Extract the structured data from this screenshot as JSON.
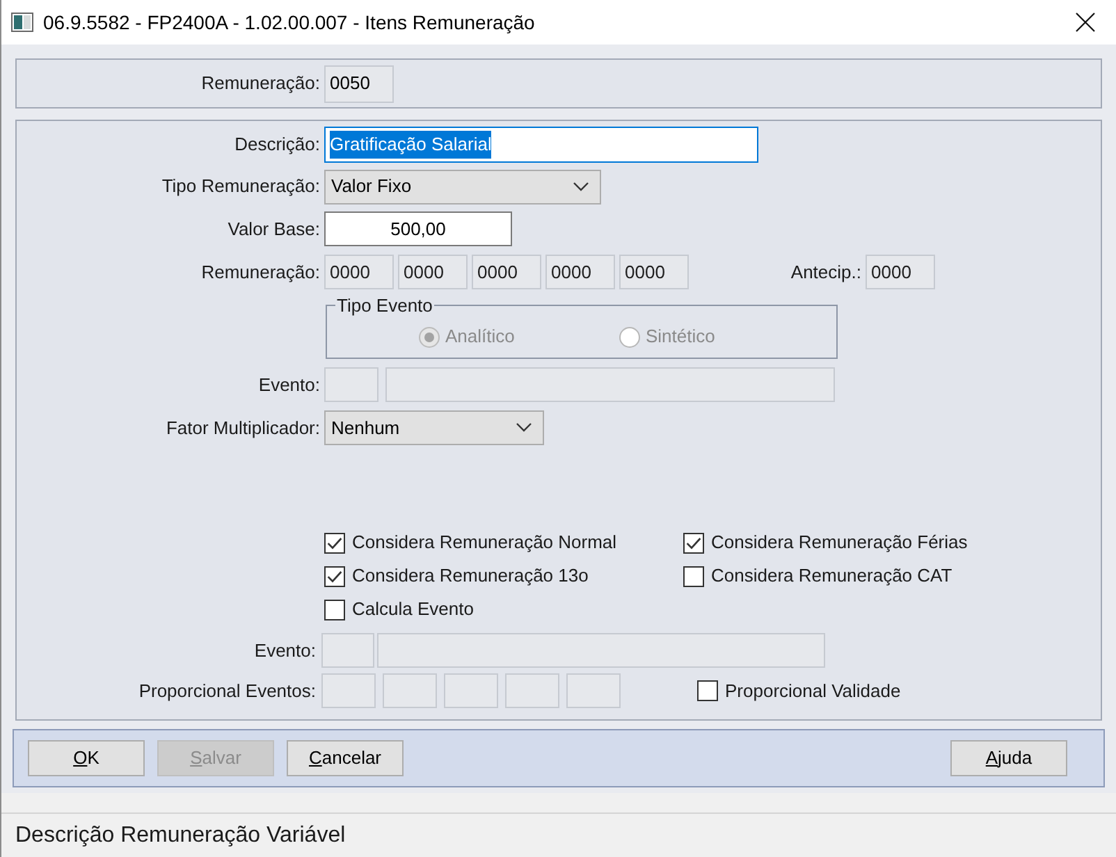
{
  "window": {
    "title": "06.9.5582 - FP2400A - 1.02.00.007 - Itens Remuneração"
  },
  "header_panel": {
    "label": "Remuneração:",
    "value": "0050",
    "disabled": true
  },
  "form": {
    "descricao": {
      "label": "Descrição:",
      "value": "Gratificação Salarial",
      "focused": true
    },
    "tipo_remuneracao": {
      "label": "Tipo Remuneração:",
      "value": "Valor Fixo"
    },
    "valor_base": {
      "label": "Valor Base:",
      "value": "500,00",
      "disabled": false
    },
    "remuneracao": {
      "label": "Remuneração:",
      "fields": [
        {
          "value": "0000",
          "disabled": true
        },
        {
          "value": "0000",
          "disabled": true
        },
        {
          "value": "0000",
          "disabled": true
        },
        {
          "value": "0000",
          "disabled": true
        },
        {
          "value": "0000",
          "disabled": true
        }
      ]
    },
    "antecip": {
      "label": "Antecip.:",
      "value": "0000",
      "disabled": true
    },
    "tipo_evento": {
      "legend": "Tipo Evento",
      "options": [
        {
          "label": "Analítico",
          "selected": true,
          "disabled": true
        },
        {
          "label": "Sintético",
          "selected": false,
          "disabled": true
        }
      ]
    },
    "evento": {
      "label": "Evento:",
      "fields": [
        {
          "disabled": true
        },
        {
          "disabled": true
        }
      ]
    },
    "fator_multiplicador": {
      "label": "Fator Multiplicador:",
      "value": "Nenhum"
    },
    "checkboxes": [
      {
        "label": "Considera Remuneração Normal",
        "checked": true
      },
      {
        "label": "Considera Remuneração Férias",
        "checked": true
      },
      {
        "label": "Considera Remuneração 13o",
        "checked": true
      },
      {
        "label": "Considera Remuneração CAT",
        "checked": false
      },
      {
        "label": "Calcula Evento",
        "checked": false
      }
    ],
    "evento_2": {
      "label": "Evento:",
      "fields": [
        {
          "disabled": true
        },
        {
          "disabled": true
        }
      ]
    },
    "proporcional_eventos": {
      "label": "Proporcional Eventos:",
      "fields": [
        {
          "disabled": true
        },
        {
          "disabled": true
        },
        {
          "disabled": true
        },
        {
          "disabled": true
        },
        {
          "disabled": true
        }
      ]
    },
    "proporcional_validade": {
      "label": "Proporcional Validade",
      "checked": false
    }
  },
  "buttons": [
    {
      "label": "OK",
      "disabled": false,
      "mnemonic": true
    },
    {
      "label": "Salvar",
      "disabled": true,
      "mnemonic": true
    },
    {
      "label": "Cancelar",
      "disabled": false,
      "mnemonic": true
    }
  ],
  "help_button": {
    "label": "Ajuda",
    "disabled": false,
    "mnemonic": true
  },
  "status_bar": {
    "text": "Descrição Remuneração Variável"
  }
}
